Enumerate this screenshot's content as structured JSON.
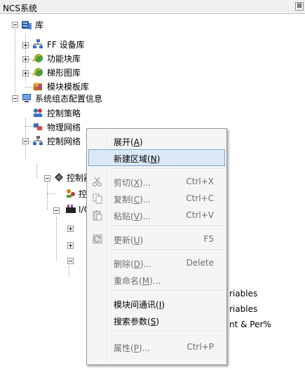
{
  "window": {
    "title": "NCS系统"
  },
  "tree": {
    "library": "库",
    "ff_device_library": "FF 设备库",
    "function_block_library": "功能块库",
    "ladder_library": "梯形图库",
    "module_template_library": "模块模板库",
    "system_config": "系统组态配置信息",
    "control_strategy": "控制策略",
    "physical_network": "物理网络",
    "control_network": "控制网络",
    "controller": "控制器",
    "strategy_child": "控",
    "io_node": "I/O",
    "variables_1": "riables",
    "variables_2": "riables",
    "extra_item": "nt & Per%"
  },
  "context_menu": {
    "items": [
      {
        "label": "展开",
        "accel": "A",
        "shortcut": "",
        "enabled": true
      },
      {
        "label": "新建区域",
        "accel": "N",
        "shortcut": "",
        "enabled": true,
        "selected": true
      },
      {
        "label": "剪切",
        "accel": "X",
        "suffix": "...",
        "shortcut": "Ctrl+X",
        "enabled": false,
        "icon": "scissors-icon"
      },
      {
        "label": "复制",
        "accel": "C",
        "suffix": "...",
        "shortcut": "Ctrl+C",
        "enabled": false,
        "icon": "copy-icon"
      },
      {
        "label": "粘贴",
        "accel": "V",
        "suffix": "...",
        "shortcut": "Ctrl+V",
        "enabled": false,
        "icon": "paste-icon"
      },
      {
        "label": "更新",
        "accel": "U",
        "shortcut": "F5",
        "enabled": false,
        "icon": "refresh-icon"
      },
      {
        "label": "删除",
        "accel": "D",
        "suffix": "...",
        "shortcut": "Delete",
        "enabled": false
      },
      {
        "label": "重命名",
        "accel": "M",
        "suffix": "...",
        "shortcut": "",
        "enabled": false
      },
      {
        "label": "模块间通讯",
        "accel": "I",
        "shortcut": "",
        "enabled": true
      },
      {
        "label": "搜索参数",
        "accel": "S",
        "shortcut": "",
        "enabled": true
      },
      {
        "label": "属性",
        "accel": "P",
        "suffix": "...",
        "shortcut": "Ctrl+P",
        "enabled": false
      }
    ]
  }
}
